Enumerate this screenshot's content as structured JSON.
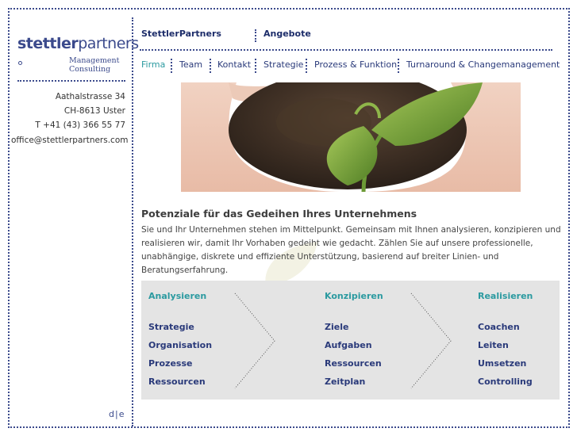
{
  "logo": {
    "main_bold": "stettler",
    "main_light": "partners",
    "sub1": "Management",
    "sub2": "Consulting"
  },
  "address": {
    "street": "Aathalstrasse 34",
    "city": "CH-8613 Uster",
    "phone": "T +41 (43) 366 55 77",
    "email": "office@stettlerpartners.com"
  },
  "lang": {
    "de": "d",
    "sep": "|",
    "en": "e"
  },
  "nav_top": {
    "left": "StettlerPartners",
    "right": "Angebote"
  },
  "nav_sub": [
    {
      "label": "Firma",
      "active": true
    },
    {
      "label": "Team"
    },
    {
      "label": "Kontakt"
    },
    {
      "label": "Strategie"
    },
    {
      "label": "Prozess & Funktion"
    },
    {
      "label": "Turnaround & Changemanagement"
    }
  ],
  "colors": {
    "brand_blue": "#3b4a8c",
    "accent_teal": "#2b9aa0",
    "dark_blue": "#2a3a7a"
  },
  "headline": "Potenziale für das Gedeihen Ihres Unternehmens",
  "paragraph": "Sie und Ihr Unternehmen stehen im Mittelpunkt. Gemeinsam mit Ihnen analysieren, konzipieren und realisieren wir, damit Ihr Vorhaben gedeiht wie gedacht. Zählen Sie auf unsere professionelle, unabhängige, diskrete und effiziente Unterstützung, basierend auf breiter Linien- und Beratungserfahrung.",
  "columns": [
    {
      "title": "Analysieren",
      "items": [
        "Strategie",
        "Organisation",
        "Prozesse",
        "Ressourcen"
      ]
    },
    {
      "title": "Konzipieren",
      "items": [
        "Ziele",
        "Aufgaben",
        "Ressourcen",
        "Zeitplan"
      ]
    },
    {
      "title": "Realisieren",
      "items": [
        "Coachen",
        "Leiten",
        "Umsetzen",
        "Controlling"
      ]
    }
  ]
}
